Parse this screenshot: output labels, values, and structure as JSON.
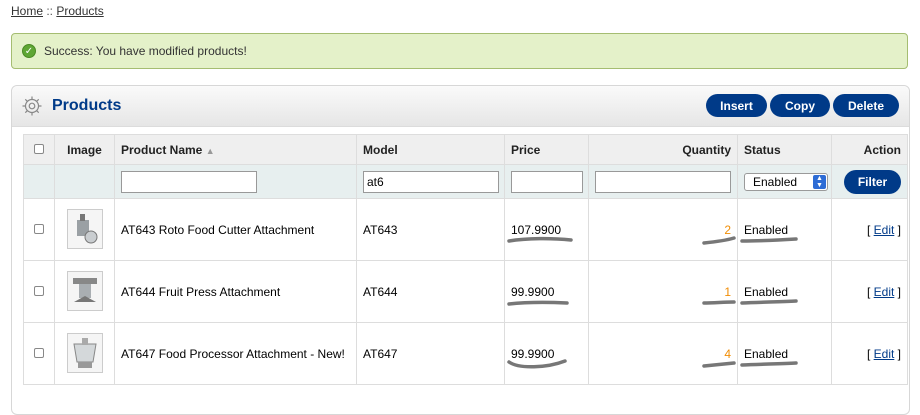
{
  "breadcrumb": {
    "home": "Home",
    "separator": " :: ",
    "current": "Products"
  },
  "alert": {
    "message": "Success: You have modified products!",
    "icon": "check-circle-icon"
  },
  "box": {
    "title": "Products",
    "icon": "gear-icon",
    "buttons": {
      "insert": "Insert",
      "copy": "Copy",
      "delete": "Delete"
    }
  },
  "table": {
    "headers": {
      "image": "Image",
      "name": "Product Name",
      "model": "Model",
      "price": "Price",
      "quantity": "Quantity",
      "status": "Status",
      "action": "Action"
    },
    "sort_indicator": "▲",
    "filters": {
      "name": "",
      "model": "at6",
      "price": "",
      "quantity": "",
      "status": "Enabled",
      "button": "Filter"
    },
    "rows": [
      {
        "name": "AT643 Roto Food Cutter Attachment",
        "model": "AT643",
        "price": "107.9900",
        "quantity": "2",
        "status": "Enabled",
        "action_open": "[ ",
        "action": "Edit",
        "action_close": " ]"
      },
      {
        "name": "AT644 Fruit Press Attachment",
        "model": "AT644",
        "price": "99.9900",
        "quantity": "1",
        "status": "Enabled",
        "action_open": "[ ",
        "action": "Edit",
        "action_close": " ]"
      },
      {
        "name": "AT647 Food Processor Attachment - New!",
        "model": "AT647",
        "price": "99.9900",
        "quantity": "4",
        "status": "Enabled",
        "action_open": "[ ",
        "action": "Edit",
        "action_close": " ]"
      }
    ]
  },
  "colors": {
    "brand": "#003a88",
    "success_bg": "#e4f1c9",
    "quantity": "#f18d05"
  }
}
